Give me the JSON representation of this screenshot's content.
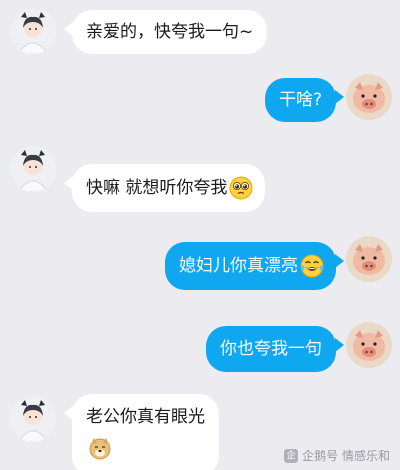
{
  "chat": {
    "messages": [
      {
        "side": "in",
        "text": "亲爱的，快夸我一句~"
      },
      {
        "side": "out",
        "text": "干啥?"
      },
      {
        "side": "in",
        "text": "快嘛  就想听你夸我",
        "emoji": "pleading-face"
      },
      {
        "side": "out",
        "text": "媳妇儿你真漂亮",
        "emoji": "tears-of-joy-face"
      },
      {
        "side": "out",
        "text": "你也夸我一句"
      },
      {
        "side": "in",
        "text": "老公你真有眼光",
        "emoji": "doge-face"
      }
    ]
  },
  "watermark": {
    "text": "企鹅号 情感乐和"
  },
  "colors": {
    "background": "#ebebf0",
    "outgoing_bubble": "#0fa7f0",
    "incoming_bubble": "#ffffff"
  }
}
